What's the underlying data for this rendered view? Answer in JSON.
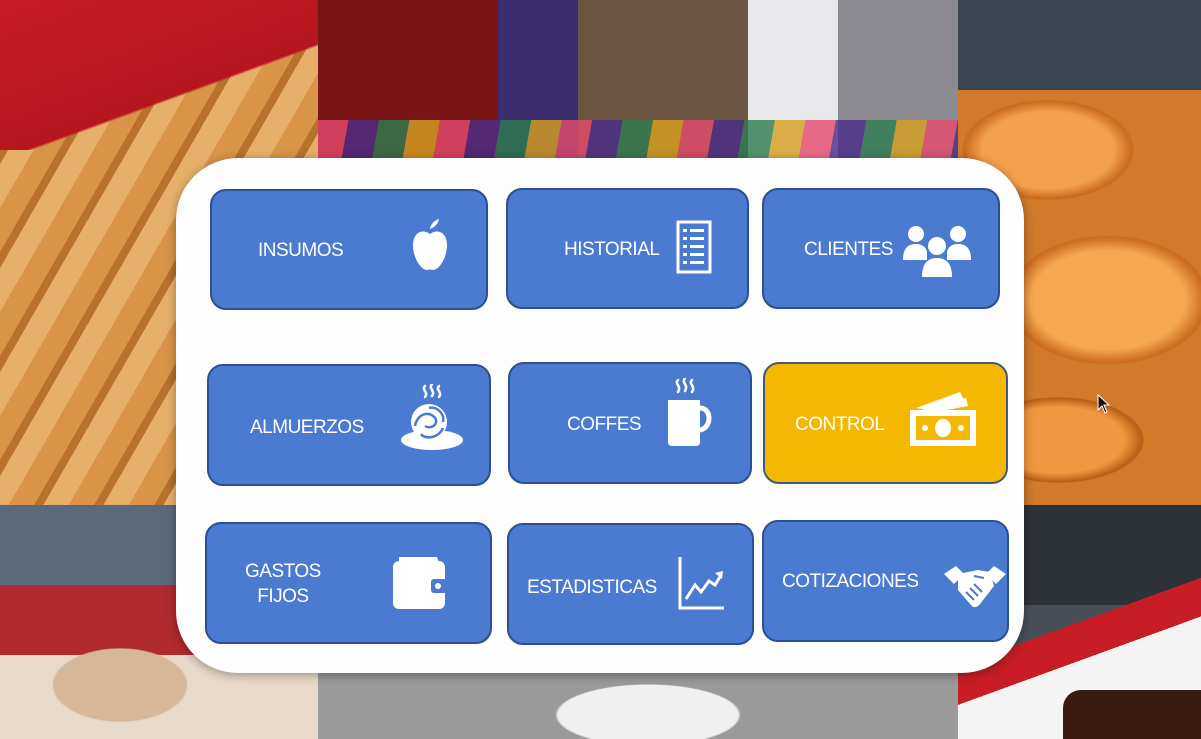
{
  "menu": {
    "buttons": [
      {
        "id": "insumos",
        "label": "INSUMOS",
        "icon": "apple-icon"
      },
      {
        "id": "historial",
        "label": "HISTORIAL",
        "icon": "list-document-icon"
      },
      {
        "id": "clientes",
        "label": "CLIENTES",
        "icon": "people-group-icon"
      },
      {
        "id": "almuerzos",
        "label": "ALMUERZOS",
        "icon": "hot-food-plate-icon"
      },
      {
        "id": "coffes",
        "label": "COFFES",
        "icon": "hot-mug-icon"
      },
      {
        "id": "control",
        "label": "CONTROL",
        "icon": "money-cash-icon",
        "active": true
      },
      {
        "id": "gastos-fijos",
        "label": "GASTOS\nFIJOS",
        "icon": "wallet-icon"
      },
      {
        "id": "estadisticas",
        "label": "ESTADISTICAS",
        "icon": "line-chart-icon"
      },
      {
        "id": "cotizaciones",
        "label": "COTIZACIONES",
        "icon": "handshake-icon"
      }
    ]
  },
  "colors": {
    "button": "#4a7bd0",
    "button_border": "#2c4f8f",
    "button_active": "#f5b800",
    "panel": "#fdfdfd"
  }
}
